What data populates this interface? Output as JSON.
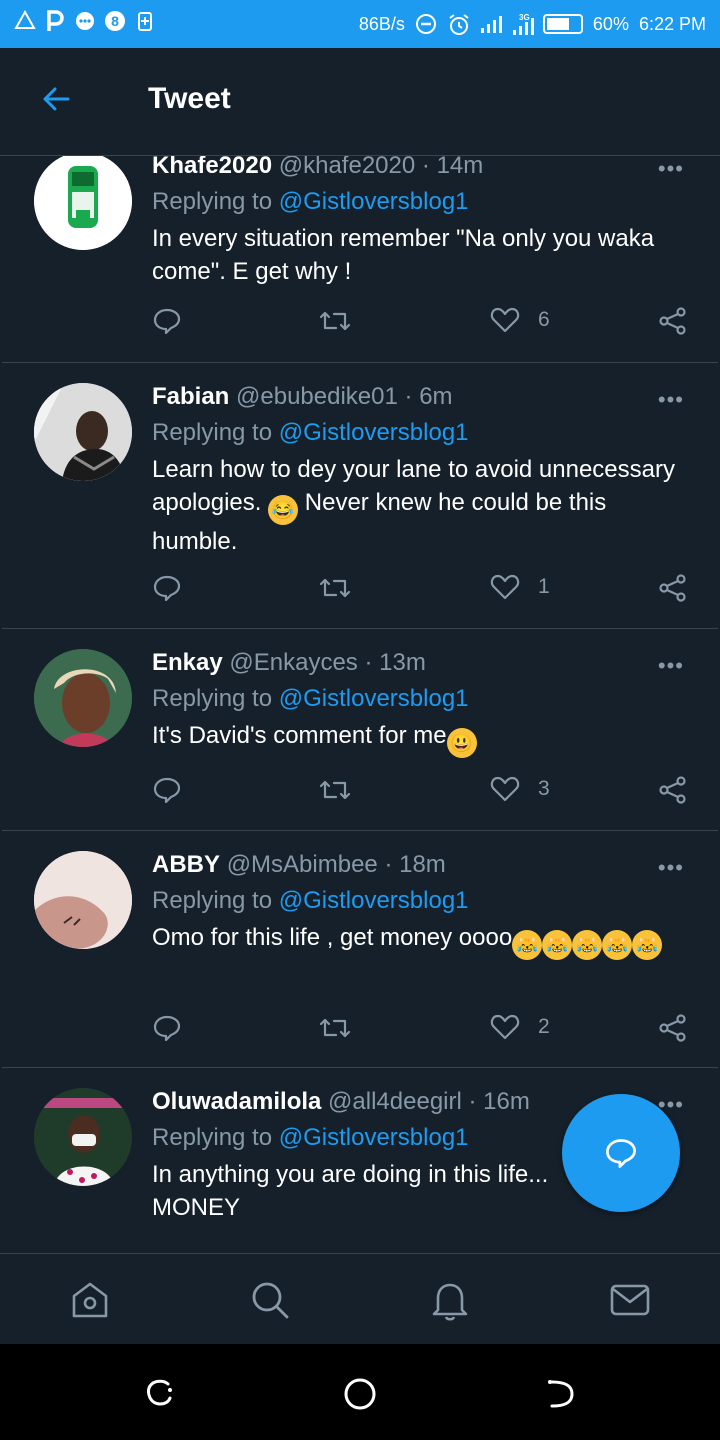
{
  "status_bar": {
    "left_icons": [
      "warning-icon",
      "parking-icon",
      "message-icon",
      "app-icon",
      "storage-icon"
    ],
    "speed": "86B/s",
    "battery": "60%",
    "time": "6:22 PM"
  },
  "header": {
    "title": "Tweet"
  },
  "tweets": [
    {
      "name": "Khafe2020",
      "handle": "@khafe2020",
      "sep": "·",
      "time": "14m",
      "replying_prefix": "Replying to ",
      "replying_to": "@Gistloversblog1",
      "text": "In every situation remember \"Na only you waka come\". E get why !",
      "likes": "6"
    },
    {
      "name": "Fabian",
      "handle": "@ebubedike01",
      "sep": "·",
      "time": "6m",
      "replying_prefix": "Replying to ",
      "replying_to": "@Gistloversblog1",
      "text_before": "Learn how to dey your lane to avoid unnecessary apologies.",
      "text_after": "Never knew he could be this humble.",
      "likes": "1"
    },
    {
      "name": "Enkay",
      "handle": "@Enkayces",
      "sep": "·",
      "time": "13m",
      "replying_prefix": "Replying to ",
      "replying_to": "@Gistloversblog1",
      "text": "It's David's comment for me",
      "likes": "3"
    },
    {
      "name": "ABBY",
      "handle": "@MsAbimbee",
      "sep": "·",
      "time": "18m",
      "replying_prefix": "Replying to ",
      "replying_to": "@Gistloversblog1",
      "text": "Omo for this life , get money oooo",
      "likes": "2"
    },
    {
      "name": "Oluwadamilola",
      "handle": "@all4deegirl",
      "sep": "·",
      "time": "16m",
      "replying_prefix": "Replying to ",
      "replying_to": "@Gistloversblog1",
      "text": "In anything you are doing in this life... MONEY"
    }
  ],
  "more_glyph": "•••",
  "colors": {
    "accent": "#1d9bf0",
    "background": "#15202b",
    "muted": "#8899a6",
    "divider": "#38444d"
  }
}
